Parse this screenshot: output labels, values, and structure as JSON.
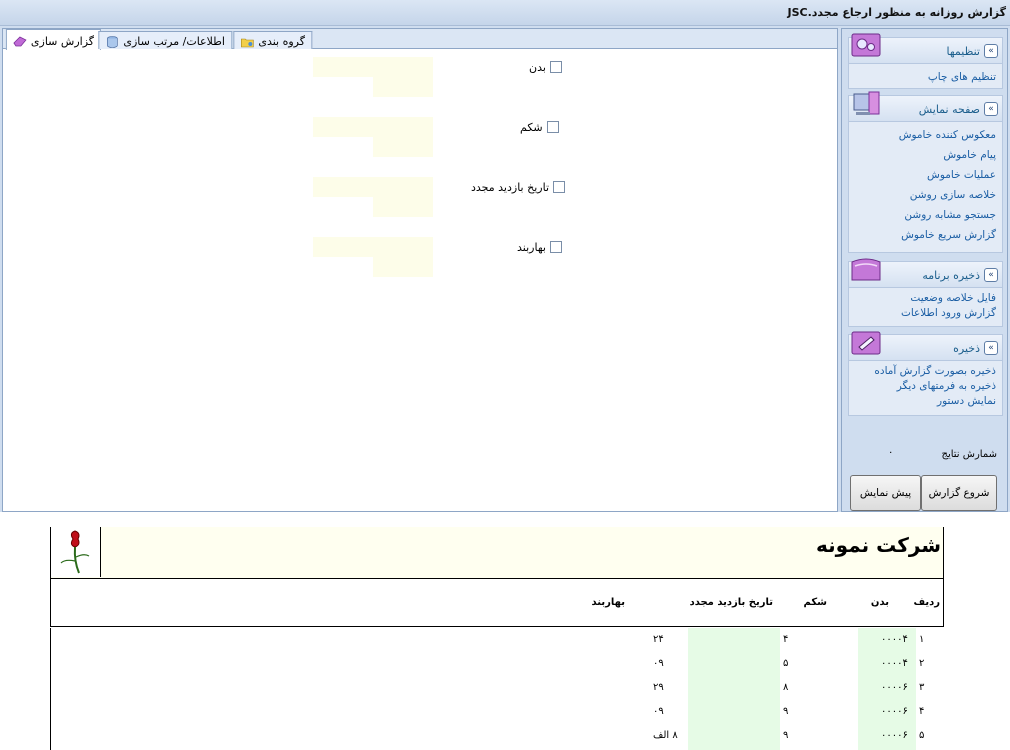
{
  "window": {
    "title": "گزارش روزانه به منظور ارجاع مجدد.JSC"
  },
  "tabs": [
    {
      "label": "گزارش سازی",
      "icon": "eraser-icon",
      "active": true
    },
    {
      "label": "اطلاعات/ مرتب سازی",
      "icon": "database-icon",
      "active": false
    },
    {
      "label": "گروه بندی",
      "icon": "folder-icon",
      "active": false
    }
  ],
  "fields": [
    {
      "label": "بدن"
    },
    {
      "label": "شکم"
    },
    {
      "label": "تاریخ بازدید مجدد"
    },
    {
      "label": "بهاربند"
    }
  ],
  "sidebar": {
    "groups": [
      {
        "title": "تنظیمها",
        "icon": "gears-icon",
        "links": [
          "تنظیم های چاپ"
        ]
      },
      {
        "title": "صفحه نمایش",
        "icon": "monitor-icon",
        "links": [
          "معکوس کننده خاموش",
          "پیام خاموش",
          "عملیات خاموش",
          "خلاصه سازی روشن",
          "جستجو مشابه روشن",
          "گزارش سریع خاموش"
        ]
      },
      {
        "title": "ذخیره برنامه",
        "icon": "save-program-icon",
        "links": [
          "فایل خلاصه وضعیت",
          "گزارش ورود اطلاعات"
        ]
      },
      {
        "title": "ذخیره",
        "icon": "save-icon",
        "links": [
          "ذخیره بصورت گزارش آماده",
          "ذخیره به فرمتهای دیگر",
          "نمایش دستور"
        ]
      }
    ],
    "results_count_label": "شمارش نتایج",
    "results_count_value": "۰",
    "start_report_button": "شروع گزارش",
    "preview_button": "پیش نمایش"
  },
  "report": {
    "company": "شرکت نمونه",
    "columns": [
      "ردیف",
      "بدن",
      "شکم",
      "تاریخ بازدید مجدد",
      "بهاربند"
    ],
    "rows": [
      {
        "row": "۱",
        "body": "۰۰۰۰۴",
        "belly": "۴",
        "date": "",
        "barn": "۲۴"
      },
      {
        "row": "۲",
        "body": "۰۰۰۰۴",
        "belly": "۵",
        "date": "",
        "barn": "۰۹"
      },
      {
        "row": "۳",
        "body": "۰۰۰۰۶",
        "belly": "۸",
        "date": "",
        "barn": "۲۹"
      },
      {
        "row": "۴",
        "body": "۰۰۰۰۶",
        "belly": "۹",
        "date": "",
        "barn": "۰۹"
      },
      {
        "row": "۵",
        "body": "۰۰۰۰۶",
        "belly": "۹",
        "date": "",
        "barn": "۸ الف"
      }
    ]
  },
  "colors": {
    "accent": "#1b5ea4",
    "panel": "#cfddef",
    "highlight_green": "#e6fbe6",
    "highlight_yellow": "#fdfde9"
  }
}
